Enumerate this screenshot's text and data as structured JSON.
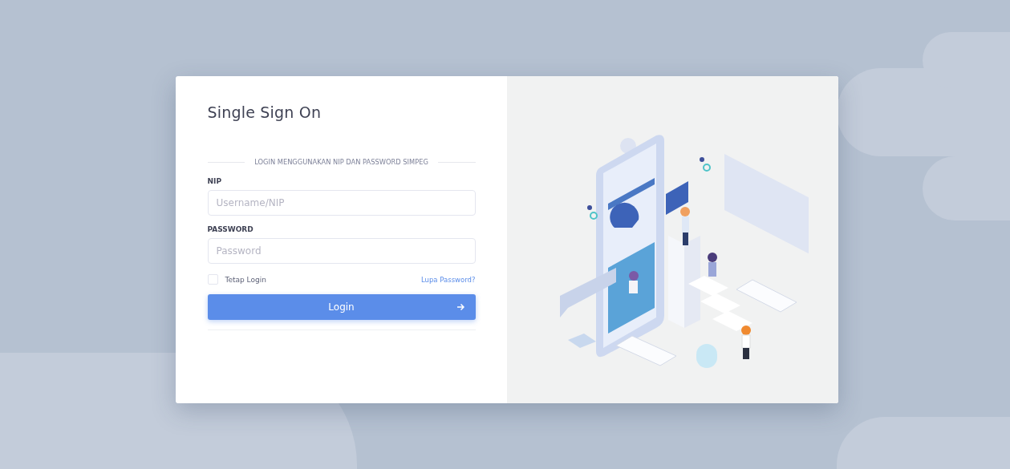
{
  "login_form": {
    "title": "Single Sign On",
    "divider_text": "LOGIN MENGGUNAKAN NIP DAN PASSWORD SIMPEG",
    "fields": [
      {
        "label": "NIP",
        "placeholder": "Username/NIP"
      },
      {
        "label": "PASSWORD",
        "placeholder": "Password"
      }
    ],
    "remember": {
      "label": "Tetap Login",
      "checked": false
    },
    "forgot_link": "Lupa Password?",
    "submit_button": "Login"
  }
}
